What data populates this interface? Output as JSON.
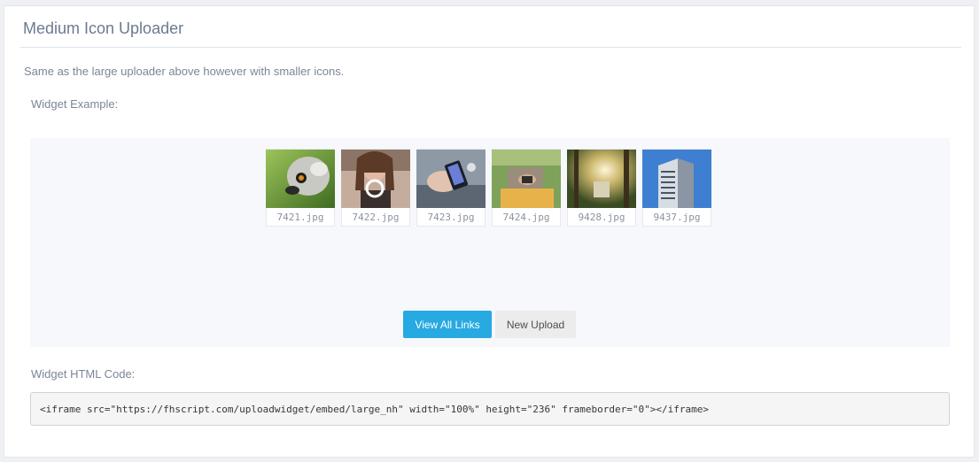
{
  "section": {
    "title": "Medium Icon Uploader",
    "description": "Same as the large uploader above however with smaller icons.",
    "widget_example_label": "Widget Example:",
    "widget_code_label": "Widget HTML Code:"
  },
  "uploads": [
    {
      "filename": "7421.jpg",
      "image": "lemur-photo"
    },
    {
      "filename": "7422.jpg",
      "image": "woman-headphones-photo"
    },
    {
      "filename": "7423.jpg",
      "image": "phone-in-hand-photo"
    },
    {
      "filename": "7424.jpg",
      "image": "person-on-grass-photo"
    },
    {
      "filename": "9428.jpg",
      "image": "forest-sunlight-photo"
    },
    {
      "filename": "9437.jpg",
      "image": "building-sky-photo"
    }
  ],
  "buttons": {
    "view_all_links": "View All Links",
    "new_upload": "New Upload"
  },
  "code": {
    "snippet": "<iframe src=\"https://fhscript.com/uploadwidget/embed/large_nh\" width=\"100%\" height=\"236\" frameborder=\"0\"></iframe>"
  },
  "colors": {
    "primary_button": "#27a9e1",
    "title_text": "#6c7a90",
    "widget_background": "#f6f8fb"
  }
}
